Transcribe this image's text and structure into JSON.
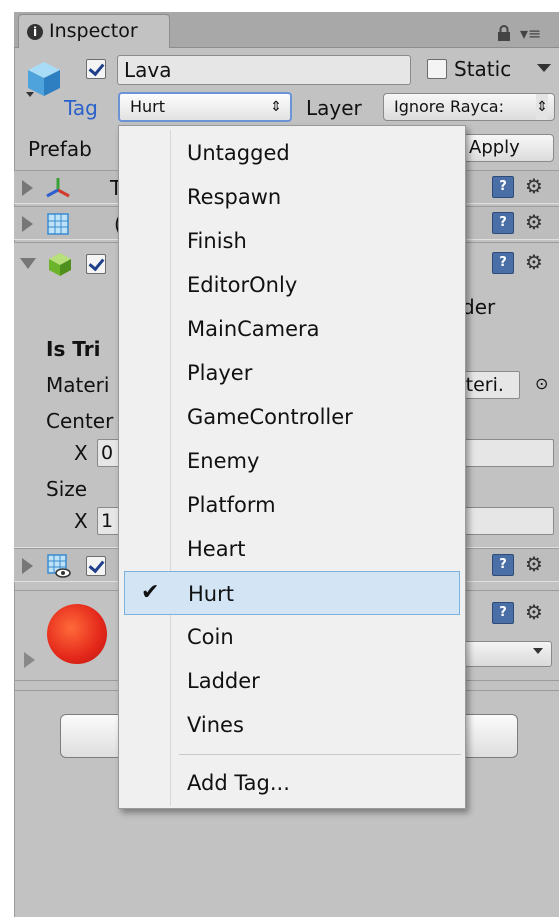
{
  "window": {
    "tab_title": "Inspector"
  },
  "object": {
    "name": "Lava",
    "active": true,
    "static_label": "Static",
    "static_checked": false,
    "tag_label": "Tag",
    "tag_value": "Hurt",
    "layer_label": "Layer",
    "layer_value": "Ignore Rayca:",
    "prefab_label": "Prefab",
    "apply_label": "Apply"
  },
  "components": {
    "t_partial": "T",
    "c_partial": "(",
    "collider_partial": "der",
    "is_trigger_label": "Is Tri",
    "material_label": "Materi",
    "material_value": "ateri.",
    "center_label": "Center",
    "center_x_label": "X",
    "center_x_value": "0",
    "size_label": "Size",
    "size_x_label": "X",
    "size_x_value": "1"
  },
  "tag_menu": {
    "items": [
      "Untagged",
      "Respawn",
      "Finish",
      "EditorOnly",
      "MainCamera",
      "Player",
      "GameController",
      "Enemy",
      "Platform",
      "Heart",
      "Hurt",
      "Coin",
      "Ladder",
      "Vines"
    ],
    "selected": "Hurt",
    "add_tag_label": "Add Tag..."
  },
  "colors": {
    "accent_blue": "#2a62c9",
    "selection_bg": "#d3e5f5",
    "panel_bg": "#c2c2c2"
  },
  "icons": [
    "info-icon",
    "lock-icon",
    "menu-icon",
    "cube-icon",
    "transform-icon",
    "grid-icon",
    "box-collider-icon",
    "mesh-renderer-icon",
    "help-icon",
    "gear-icon",
    "check-icon"
  ]
}
